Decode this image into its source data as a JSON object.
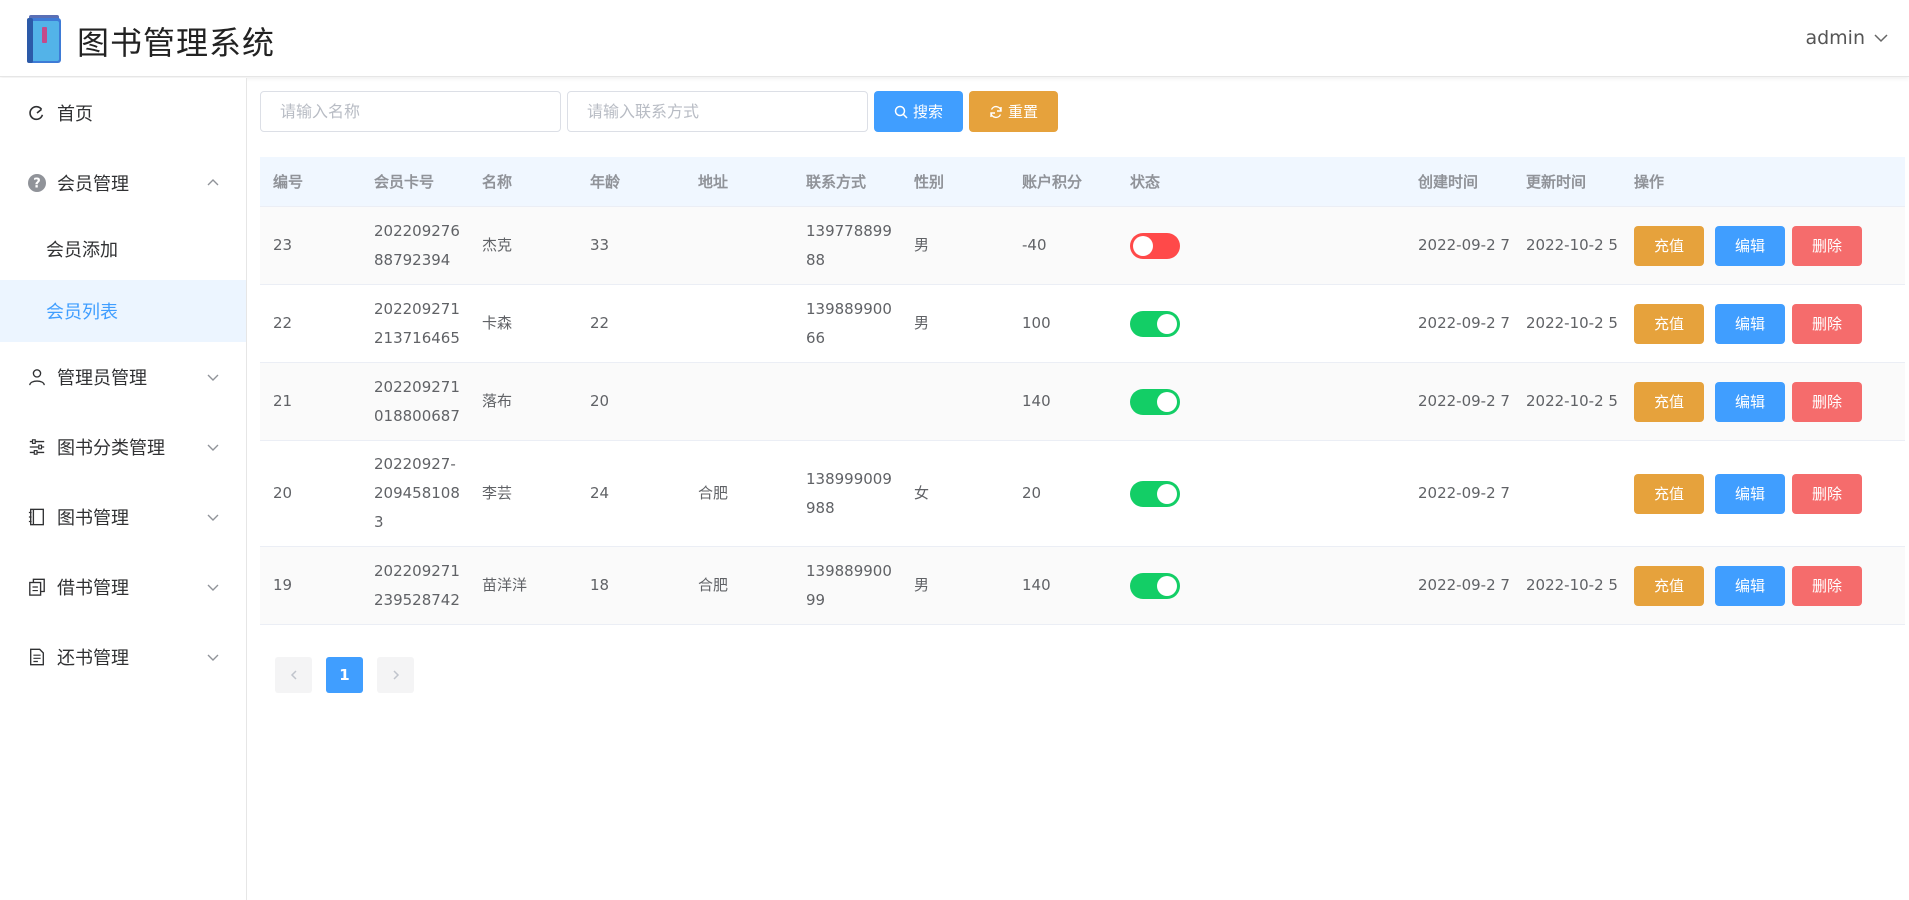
{
  "header": {
    "title": "图书管理系统",
    "user": "admin"
  },
  "sidebar": {
    "items": [
      {
        "label": "首页",
        "icon": "dashboard-icon"
      },
      {
        "label": "会员管理",
        "icon": "question-circle-icon",
        "expanded": true,
        "children": [
          {
            "label": "会员添加"
          },
          {
            "label": "会员列表",
            "active": true
          }
        ]
      },
      {
        "label": "管理员管理",
        "icon": "user-icon"
      },
      {
        "label": "图书分类管理",
        "icon": "sliders-icon"
      },
      {
        "label": "图书管理",
        "icon": "notebook-icon"
      },
      {
        "label": "借书管理",
        "icon": "document-copy-icon"
      },
      {
        "label": "还书管理",
        "icon": "document-icon"
      }
    ]
  },
  "search": {
    "name_placeholder": "请输入名称",
    "contact_placeholder": "请输入联系方式",
    "search_label": "搜索",
    "reset_label": "重置"
  },
  "table": {
    "headers": [
      "编号",
      "会员卡号",
      "名称",
      "年龄",
      "地址",
      "联系方式",
      "性别",
      "账户积分",
      "状态",
      "创建时间",
      "更新时间",
      "操作"
    ],
    "rows": [
      {
        "id": "23",
        "card": "202209276 88792394",
        "name": "杰克",
        "age": "33",
        "address": "",
        "contact": "139778899 88",
        "gender": "男",
        "points": "-40",
        "status": false,
        "created": "2022-09-2 7",
        "updated": "2022-10-2 5"
      },
      {
        "id": "22",
        "card": "202209271 213716465",
        "name": "卡森",
        "age": "22",
        "address": "",
        "contact": "139889900 66",
        "gender": "男",
        "points": "100",
        "status": true,
        "created": "2022-09-2 7",
        "updated": "2022-10-2 5"
      },
      {
        "id": "21",
        "card": "202209271 018800687",
        "name": "落布",
        "age": "20",
        "address": "",
        "contact": "",
        "gender": "",
        "points": "140",
        "status": true,
        "created": "2022-09-2 7",
        "updated": "2022-10-2 5"
      },
      {
        "id": "20",
        "card": "20220927- 209458108 3",
        "name": "李芸",
        "age": "24",
        "address": "合肥",
        "contact": "138999009 988",
        "gender": "女",
        "points": "20",
        "status": true,
        "created": "2022-09-2 7",
        "updated": ""
      },
      {
        "id": "19",
        "card": "202209271 239528742",
        "name": "苗洋洋",
        "age": "18",
        "address": "合肥",
        "contact": "139889900 99",
        "gender": "男",
        "points": "140",
        "status": true,
        "created": "2022-09-2 7",
        "updated": "2022-10-2 5"
      }
    ],
    "actions": {
      "charge": "充值",
      "edit": "编辑",
      "delete": "删除"
    }
  },
  "pagination": {
    "current": "1"
  },
  "colors": {
    "primary": "#409eff",
    "warning": "#e6a23c",
    "danger": "#f56c6c",
    "switch_on": "#13ce66",
    "switch_off": "#ff4949"
  }
}
